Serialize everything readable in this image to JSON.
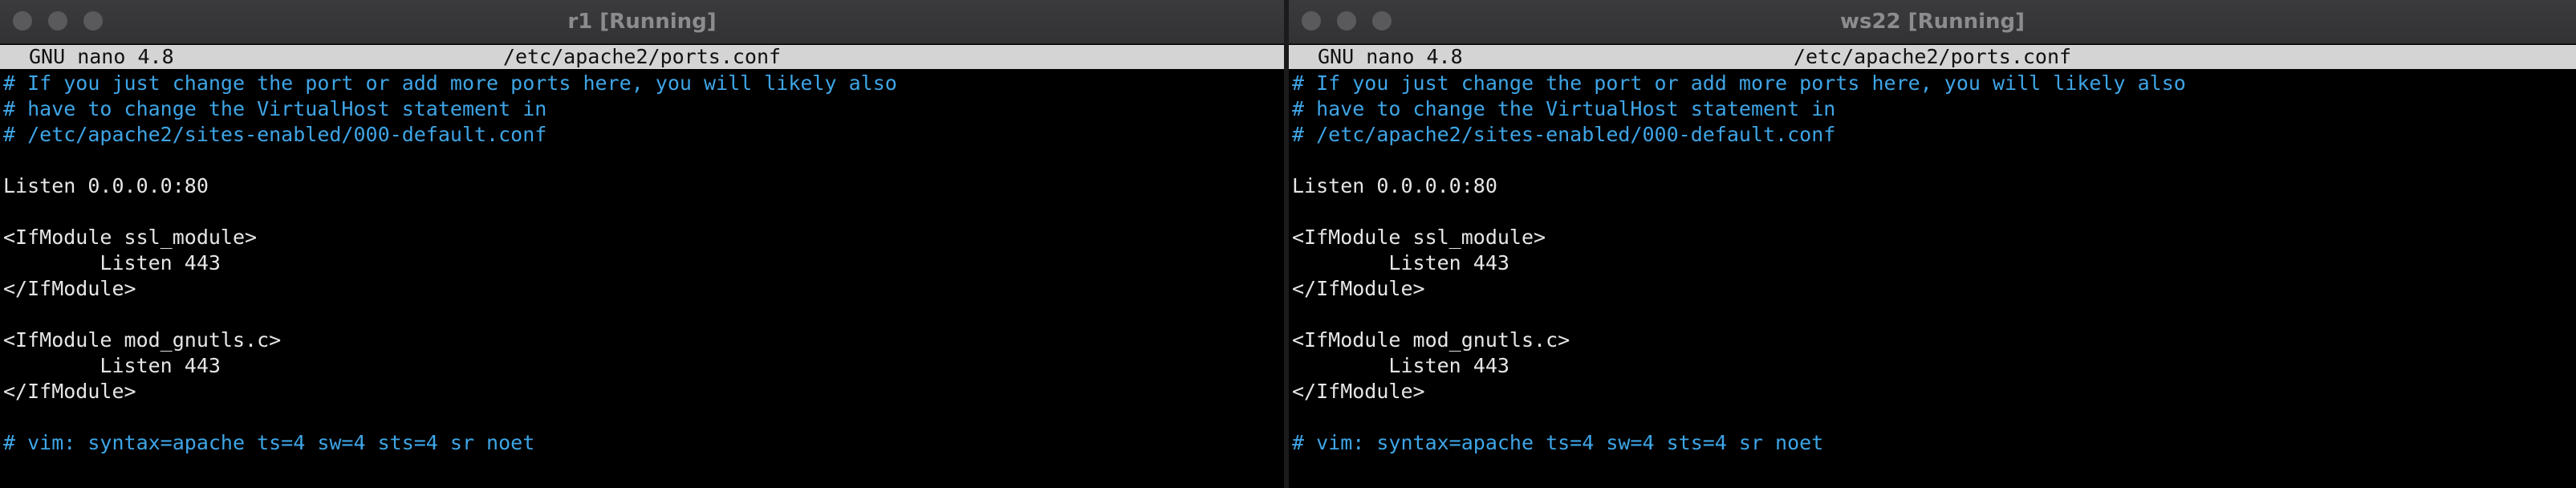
{
  "windows": [
    {
      "title": "r1 [Running]",
      "nano": {
        "program": "GNU nano 4.8",
        "filename": "/etc/apache2/ports.conf"
      },
      "lines": [
        {
          "text": "# If you just change the port or add more ports here, you will likely also",
          "kind": "comment"
        },
        {
          "text": "# have to change the VirtualHost statement in",
          "kind": "comment"
        },
        {
          "text": "# /etc/apache2/sites-enabled/000-default.conf",
          "kind": "comment"
        },
        {
          "text": "",
          "kind": "plain"
        },
        {
          "text": "Listen 0.0.0.0:80",
          "kind": "plain"
        },
        {
          "text": "",
          "kind": "plain"
        },
        {
          "text": "<IfModule ssl_module>",
          "kind": "plain"
        },
        {
          "text": "        Listen 443",
          "kind": "plain"
        },
        {
          "text": "</IfModule>",
          "kind": "plain"
        },
        {
          "text": "",
          "kind": "plain"
        },
        {
          "text": "<IfModule mod_gnutls.c>",
          "kind": "plain"
        },
        {
          "text": "        Listen 443",
          "kind": "plain"
        },
        {
          "text": "</IfModule>",
          "kind": "plain"
        },
        {
          "text": "",
          "kind": "plain"
        },
        {
          "text": "# vim: syntax=apache ts=4 sw=4 sts=4 sr noet",
          "kind": "comment"
        }
      ]
    },
    {
      "title": "ws22 [Running]",
      "nano": {
        "program": "GNU nano 4.8",
        "filename": "/etc/apache2/ports.conf"
      },
      "lines": [
        {
          "text": "# If you just change the port or add more ports here, you will likely also",
          "kind": "comment"
        },
        {
          "text": "# have to change the VirtualHost statement in",
          "kind": "comment"
        },
        {
          "text": "# /etc/apache2/sites-enabled/000-default.conf",
          "kind": "comment"
        },
        {
          "text": "",
          "kind": "plain"
        },
        {
          "text": "Listen 0.0.0.0:80",
          "kind": "plain"
        },
        {
          "text": "",
          "kind": "plain"
        },
        {
          "text": "<IfModule ssl_module>",
          "kind": "plain"
        },
        {
          "text": "        Listen 443",
          "kind": "plain"
        },
        {
          "text": "</IfModule>",
          "kind": "plain"
        },
        {
          "text": "",
          "kind": "plain"
        },
        {
          "text": "<IfModule mod_gnutls.c>",
          "kind": "plain"
        },
        {
          "text": "        Listen 443",
          "kind": "plain"
        },
        {
          "text": "</IfModule>",
          "kind": "plain"
        },
        {
          "text": "",
          "kind": "plain"
        },
        {
          "text": "# vim: syntax=apache ts=4 sw=4 sts=4 sr noet",
          "kind": "comment"
        }
      ]
    }
  ],
  "colors": {
    "comment": "#3ea5e6",
    "text": "#e6e6e6",
    "terminal_bg": "#000000",
    "header_bg": "#d4d4d4"
  }
}
